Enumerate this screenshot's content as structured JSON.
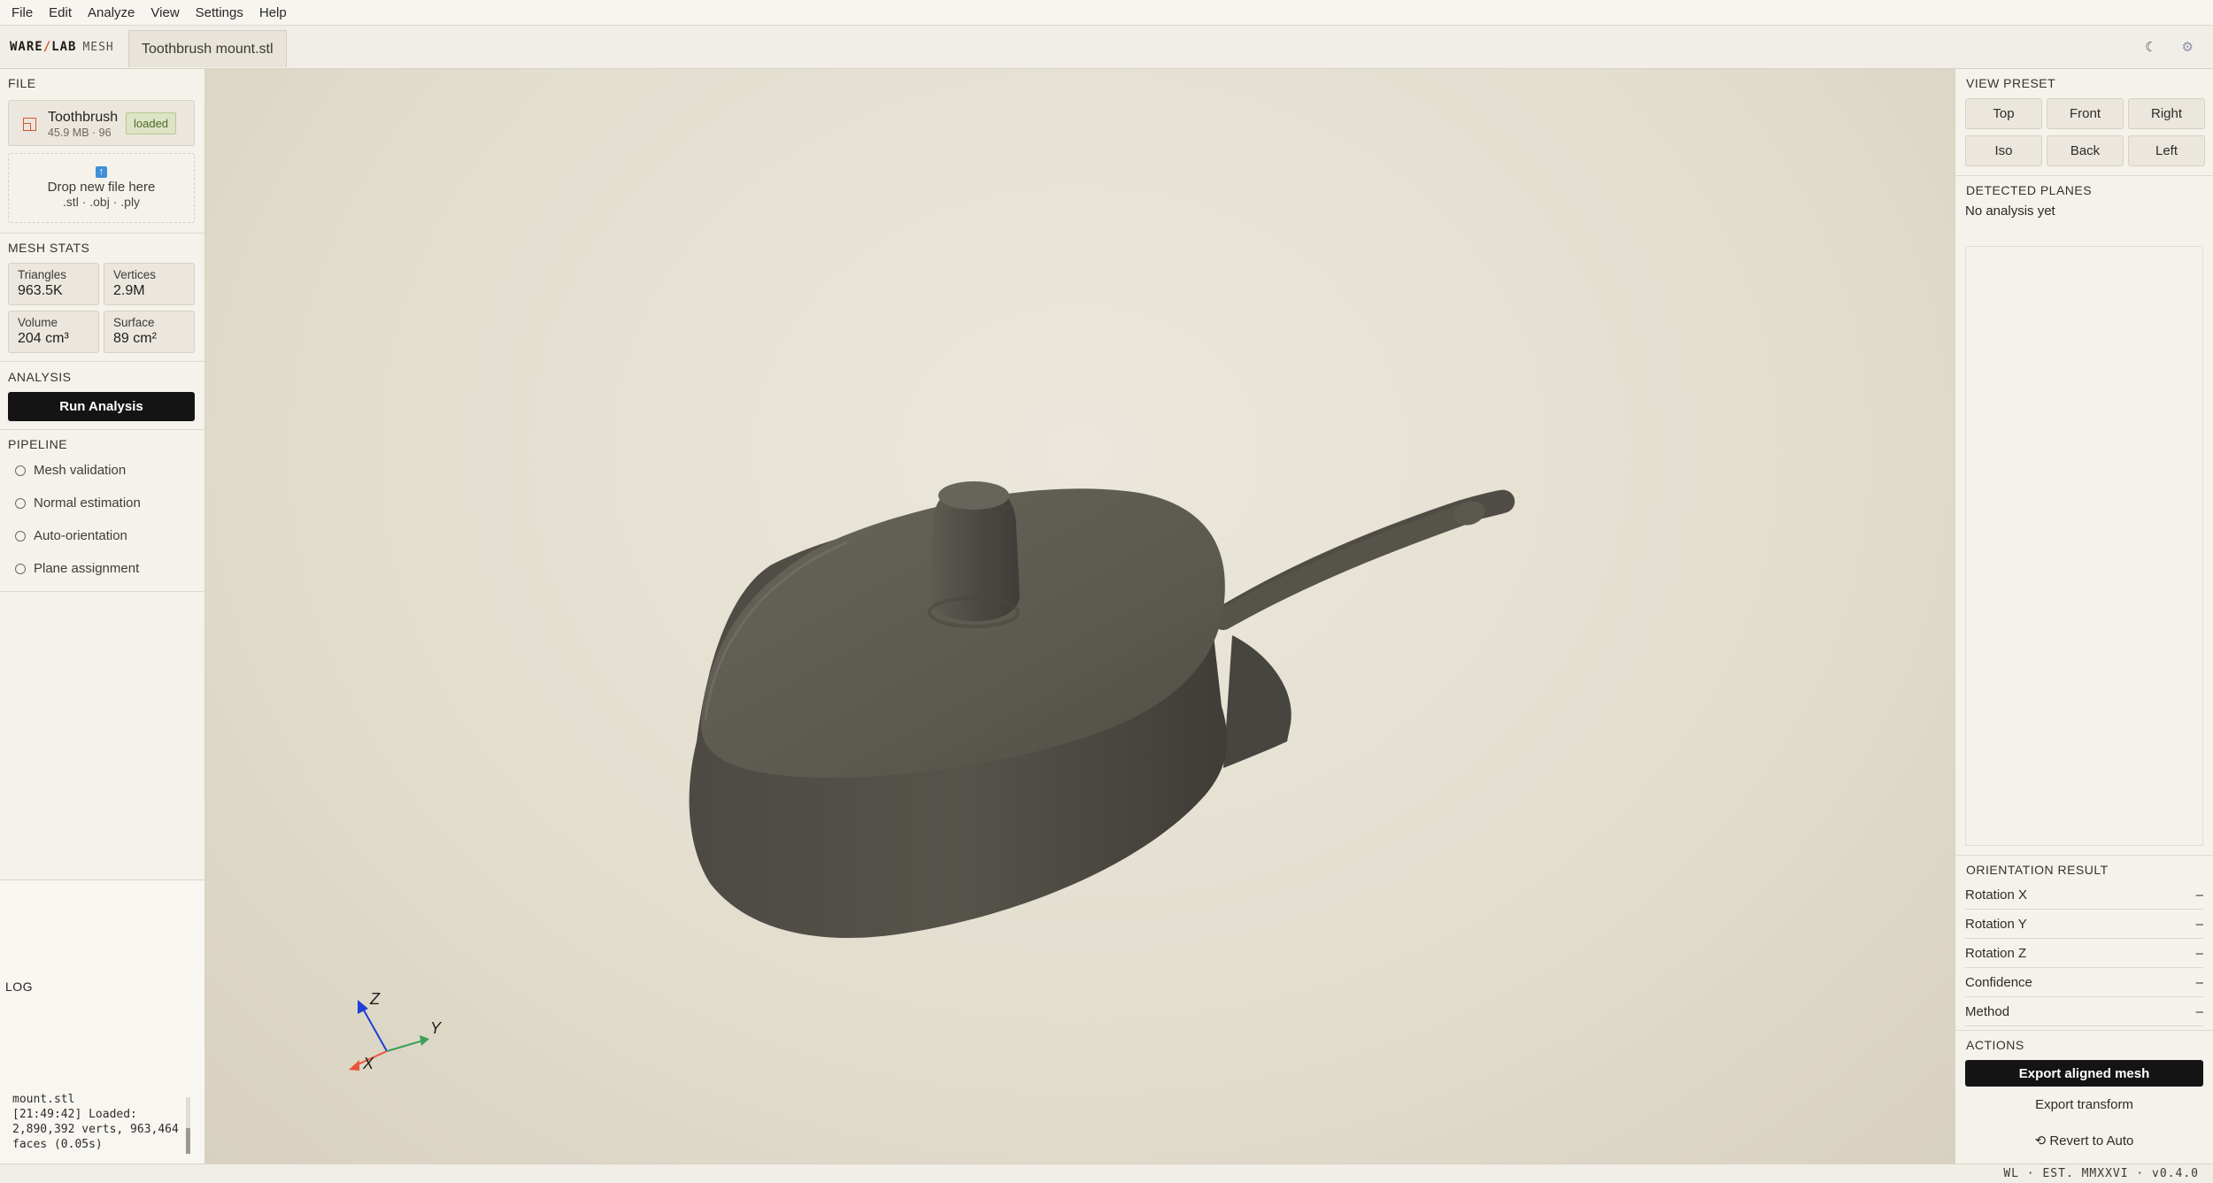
{
  "menubar": {
    "items": [
      "File",
      "Edit",
      "Analyze",
      "View",
      "Settings",
      "Help"
    ]
  },
  "brand": {
    "part1": "WARE",
    "slash": "/",
    "part2": "LAB",
    "part3": "MESH"
  },
  "tab": {
    "filename": "Toothbrush mount.stl"
  },
  "toolbar": {
    "theme_icon": "☾",
    "settings_icon": "⚙"
  },
  "file_section": {
    "title": "FILE",
    "name": "Toothbrush",
    "meta": "45.9 MB · 96",
    "status": "loaded",
    "drop_title": "Drop new file here",
    "drop_types": ".stl · .obj · .ply"
  },
  "mesh_stats": {
    "title": "MESH STATS",
    "triangles_label": "Triangles",
    "triangles": "963.5K",
    "vertices_label": "Vertices",
    "vertices": "2.9M",
    "volume_label": "Volume",
    "volume": "204 cm³",
    "surface_label": "Surface",
    "surface": "89 cm²"
  },
  "analysis": {
    "title": "ANALYSIS",
    "run_label": "Run Analysis"
  },
  "pipeline": {
    "title": "PIPELINE",
    "steps": [
      "Mesh validation",
      "Normal estimation",
      "Auto-orientation",
      "Plane assignment"
    ]
  },
  "log": {
    "title": "LOG",
    "text": "mount.stl\n[21:49:42] Loaded:\n2,890,392 verts, 963,464\nfaces (0.05s)"
  },
  "axes": {
    "x": "X",
    "y": "Y",
    "z": "Z",
    "x_color": "#e8553a",
    "y_color": "#3aa058",
    "z_color": "#1f3fd8"
  },
  "view_preset": {
    "title": "VIEW PRESET",
    "buttons": [
      "Top",
      "Front",
      "Right",
      "Iso",
      "Back",
      "Left"
    ]
  },
  "detected_planes": {
    "title": "DETECTED PLANES",
    "empty": "No analysis yet"
  },
  "orientation": {
    "title": "ORIENTATION RESULT",
    "rows": [
      {
        "label": "Rotation X",
        "value": "–"
      },
      {
        "label": "Rotation Y",
        "value": "–"
      },
      {
        "label": "Rotation Z",
        "value": "–"
      },
      {
        "label": "Confidence",
        "value": "–"
      },
      {
        "label": "Method",
        "value": "–"
      }
    ]
  },
  "actions": {
    "title": "ACTIONS",
    "export_mesh": "Export aligned mesh",
    "export_transform": "Export transform",
    "revert": "⟲ Revert to Auto"
  },
  "statusbar": {
    "text": "WL · EST. MMXXVI · v0.4.0"
  },
  "colors": {
    "model": "#57554c",
    "accent": "#d8532c",
    "loaded_badge": "#dde3c5"
  }
}
